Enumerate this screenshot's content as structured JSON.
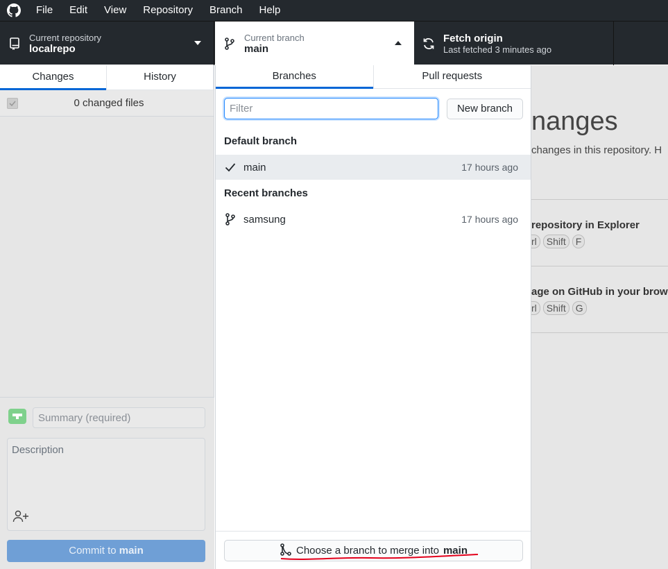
{
  "menubar": {
    "logo": "github-icon",
    "items": [
      "File",
      "Edit",
      "View",
      "Repository",
      "Branch",
      "Help"
    ]
  },
  "toolbar": {
    "repo": {
      "sub": "Current repository",
      "name": "localrepo"
    },
    "branch": {
      "sub": "Current branch",
      "name": "main"
    },
    "fetch": {
      "title": "Fetch origin",
      "sub": "Last fetched 3 minutes ago"
    }
  },
  "sidebar": {
    "tabs": [
      "Changes",
      "History"
    ],
    "changed_files": "0 changed files",
    "summary_placeholder": "Summary (required)",
    "description_placeholder": "Description",
    "commit_prefix": "Commit to",
    "commit_branch": "main"
  },
  "main": {
    "title_fragment": "nanges",
    "subtitle_fragment": "changes in this repository. H",
    "actions": [
      {
        "title": "repository in Explorer",
        "keys": [
          "rl",
          "Shift",
          "F"
        ]
      },
      {
        "title": "age on GitHub in your brow",
        "keys": [
          "rl",
          "Shift",
          "G"
        ]
      }
    ]
  },
  "popup": {
    "tabs": [
      "Branches",
      "Pull requests"
    ],
    "filter_placeholder": "Filter",
    "new_branch": "New branch",
    "default_heading": "Default branch",
    "recent_heading": "Recent branches",
    "default_branch": {
      "name": "main",
      "time": "17 hours ago"
    },
    "recent_branches": [
      {
        "name": "samsung",
        "time": "17 hours ago"
      }
    ],
    "merge_prefix": "Choose a branch to merge into",
    "merge_target": "main"
  },
  "colors": {
    "accent": "#0366d6",
    "toolbar_bg": "#24292e",
    "annotation": "#e3001b"
  }
}
